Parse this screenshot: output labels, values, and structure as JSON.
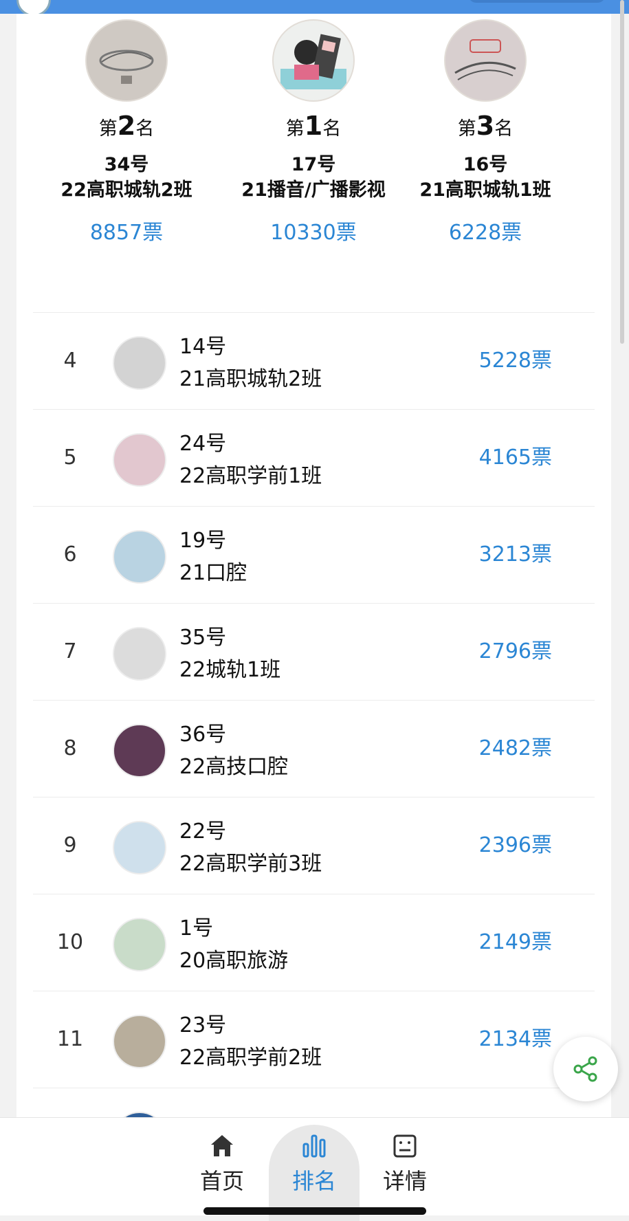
{
  "podium": [
    {
      "rank_prefix": "第",
      "rank_num": "2",
      "rank_suffix": "名",
      "no": "34号",
      "class_name": "22高职城轨2班",
      "votes": "8857票"
    },
    {
      "rank_prefix": "第",
      "rank_num": "1",
      "rank_suffix": "名",
      "no": "17号",
      "class_name": "21播音/广播影视",
      "votes": "10330票"
    },
    {
      "rank_prefix": "第",
      "rank_num": "3",
      "rank_suffix": "名",
      "no": "16号",
      "class_name": "21高职城轨1班",
      "votes": "6228票"
    }
  ],
  "rankings": [
    {
      "rank": "4",
      "no": "14号",
      "class_name": "21高职城轨2班",
      "votes": "5228票"
    },
    {
      "rank": "5",
      "no": "24号",
      "class_name": "22高职学前1班",
      "votes": "4165票"
    },
    {
      "rank": "6",
      "no": "19号",
      "class_name": "21口腔",
      "votes": "3213票"
    },
    {
      "rank": "7",
      "no": "35号",
      "class_name": "22城轨1班",
      "votes": "2796票"
    },
    {
      "rank": "8",
      "no": "36号",
      "class_name": "22高技口腔",
      "votes": "2482票"
    },
    {
      "rank": "9",
      "no": "22号",
      "class_name": "22高职学前3班",
      "votes": "2396票"
    },
    {
      "rank": "10",
      "no": "1号",
      "class_name": "20高职旅游",
      "votes": "2149票"
    },
    {
      "rank": "11",
      "no": "23号",
      "class_name": "22高职学前2班",
      "votes": "2134票"
    }
  ],
  "tabs": [
    {
      "label": "首页",
      "icon": "home-icon"
    },
    {
      "label": "排名",
      "icon": "bar-chart-icon"
    },
    {
      "label": "详情",
      "icon": "details-icon"
    }
  ],
  "share_icon": "share-icon",
  "colors": {
    "accent": "#2b86d4",
    "top_bar": "#4a90e2"
  }
}
